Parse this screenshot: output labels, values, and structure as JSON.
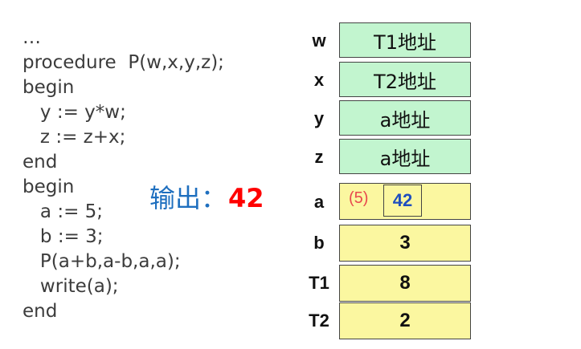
{
  "code_lines": [
    "…",
    "procedure  P(w,x,y,z);",
    "begin",
    "   y := y*w;",
    "   z := z+x;",
    "end",
    "begin",
    "   a := 5;",
    "   b := 3;",
    "   P(a+b,a-b,a,a);",
    "   write(a);",
    "end"
  ],
  "output": {
    "label": "输出：",
    "value": "42"
  },
  "memory": [
    {
      "name": "w",
      "value": "T1地址",
      "color": "#c2f5cf"
    },
    {
      "name": "x",
      "value": "T2地址",
      "color": "#c2f5cf"
    },
    {
      "name": "y",
      "value": "a地址",
      "color": "#c2f5cf"
    },
    {
      "name": "z",
      "value": "a地址",
      "color": "#c2f5cf"
    },
    {
      "name": "a",
      "value": "",
      "annotation": "(5)",
      "inner_value": "42",
      "color": "#fbf7a0"
    },
    {
      "name": "b",
      "value": "3",
      "color": "#fbf7a0"
    },
    {
      "name": "T1",
      "value": "8",
      "color": "#fbf7a0"
    },
    {
      "name": "T2",
      "value": "2",
      "color": "#fbf7a0"
    }
  ]
}
